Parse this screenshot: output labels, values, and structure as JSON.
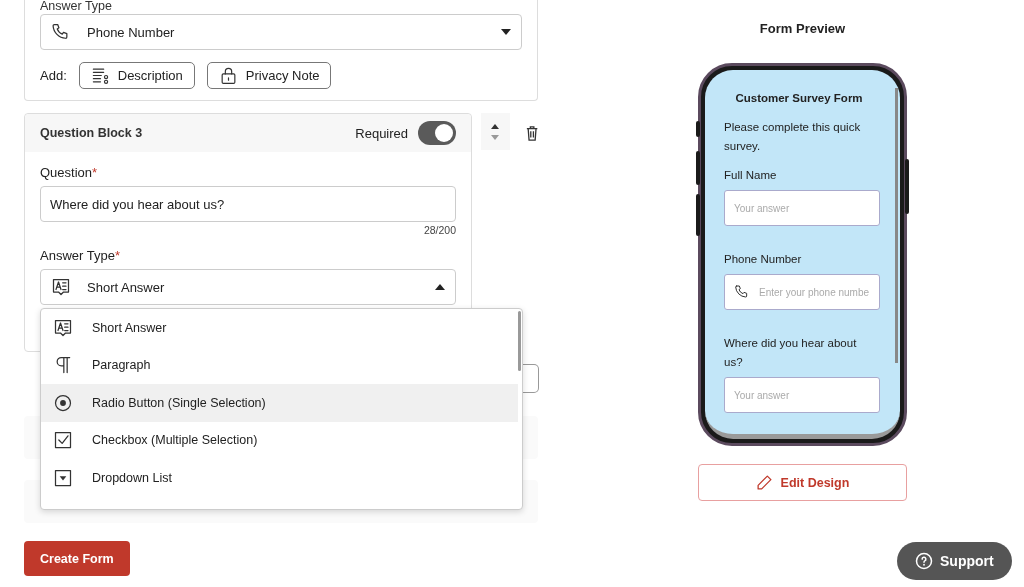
{
  "previous_block": {
    "answer_type_label": "Answer Type",
    "answer_type": {
      "value": "Phone Number",
      "kind": "phone"
    },
    "add_label": "Add:",
    "add_buttons": [
      {
        "label": "Description",
        "kind": "description"
      },
      {
        "label": "Privacy Note",
        "kind": "lock"
      }
    ]
  },
  "question_block": {
    "title": "Question Block 3",
    "required_label": "Required",
    "required": true,
    "question_label": "Question",
    "question_mark": "*",
    "question_value": "Where did you hear about us?",
    "counter": "28/200",
    "answer_type_label": "Answer Type",
    "answer_type_mark": "*",
    "answer_type": {
      "value": "Short Answer",
      "kind": "short",
      "expanded": true
    }
  },
  "answer_type_menu": [
    {
      "label": "Short Answer",
      "kind": "short",
      "selected": false
    },
    {
      "label": "Paragraph",
      "kind": "paragraph",
      "selected": false
    },
    {
      "label": "Radio Button (Single Selection)",
      "kind": "radio",
      "selected": true
    },
    {
      "label": "Checkbox (Multiple Selection)",
      "kind": "checkbox",
      "selected": false
    },
    {
      "label": "Dropdown List",
      "kind": "dropdown",
      "selected": false
    }
  ],
  "create_button": "Create Form",
  "preview": {
    "title": "Form Preview",
    "form_title": "Customer Survey Form",
    "description": "Please complete this quick survey.",
    "fields": [
      {
        "label": "Full Name",
        "placeholder": "Your answer",
        "kind": "text"
      },
      {
        "label": "Phone Number",
        "placeholder": "Enter your phone numbe",
        "kind": "phone"
      },
      {
        "label": "Where did you hear about us?",
        "placeholder": "Your answer",
        "kind": "text"
      }
    ],
    "edit_button": "Edit Design"
  },
  "support_button": "Support"
}
